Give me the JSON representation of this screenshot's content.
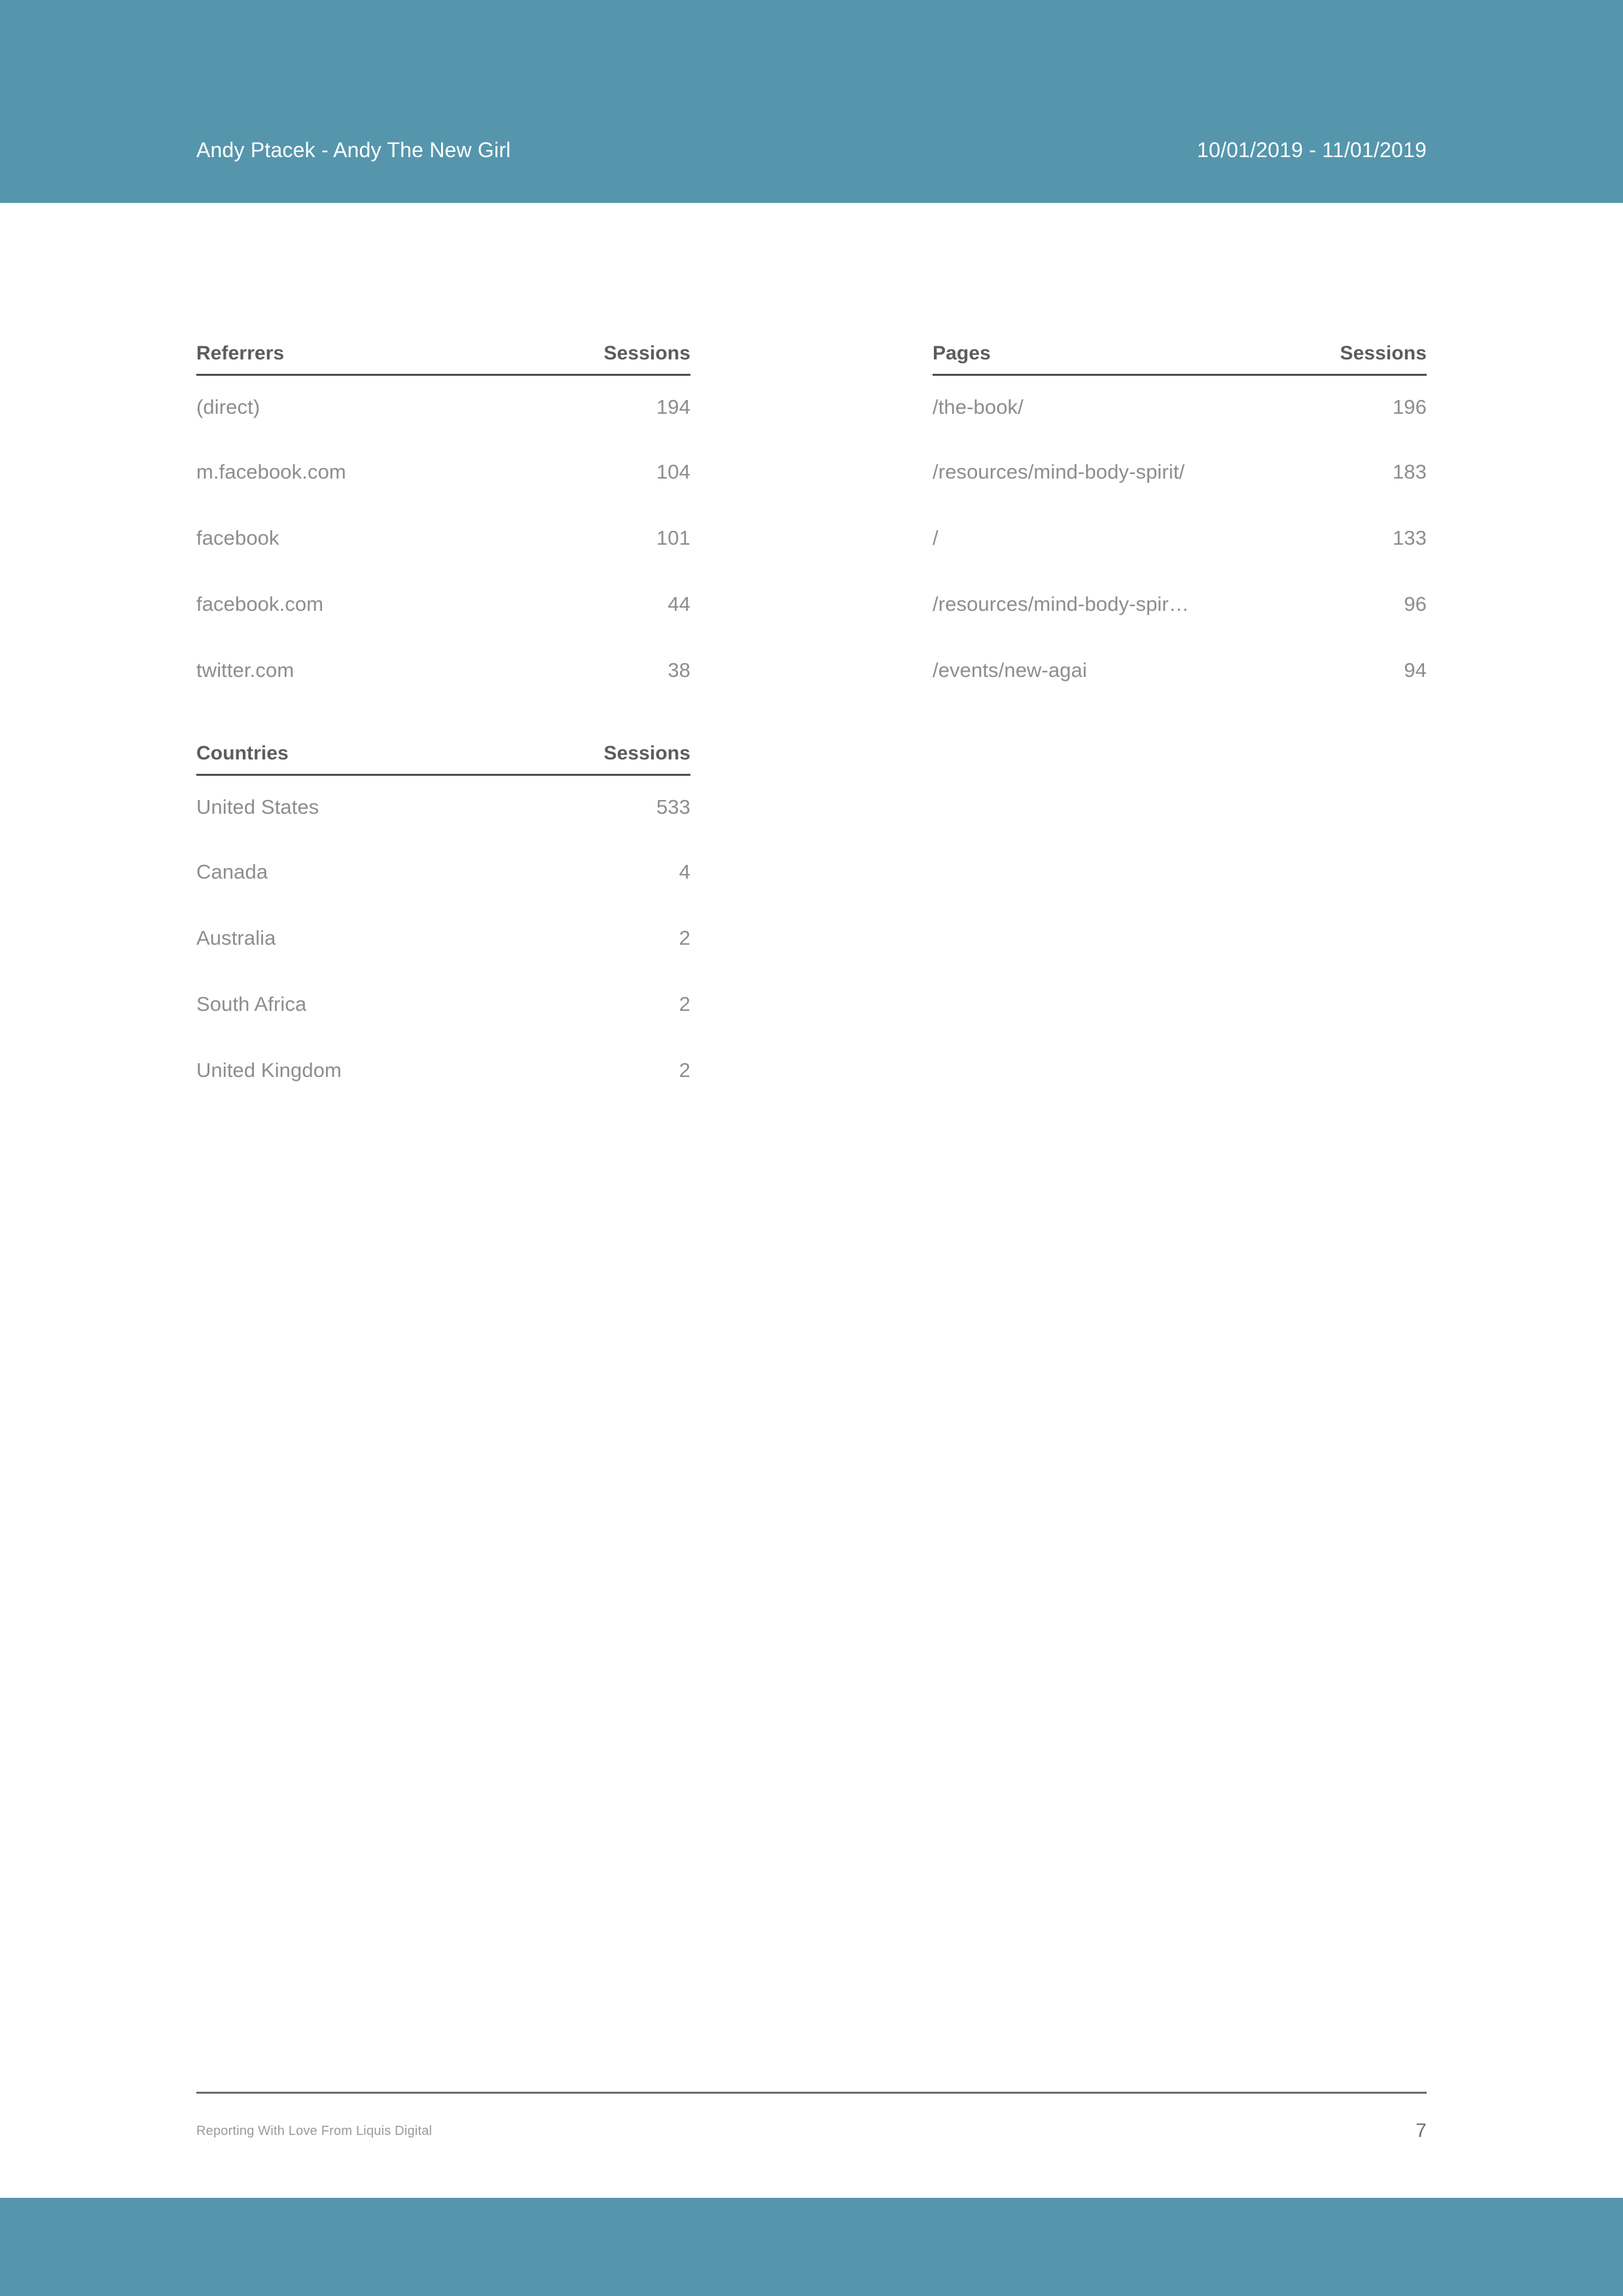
{
  "brand": {
    "band_color": "#5596ad",
    "header_text_color": "#ffffff",
    "rule_color": "#4c4c50",
    "header_label_color": "#5c5c60",
    "row_text_color": "#8d8d91"
  },
  "header": {
    "title": "Andy Ptacek - Andy The New Girl",
    "date_range": "10/01/2019 - 11/01/2019"
  },
  "tables": {
    "referrers": {
      "columns": [
        "Referrers",
        "Sessions"
      ],
      "rows": [
        {
          "label": "(direct)",
          "value": "194"
        },
        {
          "label": "m.facebook.com",
          "value": "104"
        },
        {
          "label": "facebook",
          "value": "101"
        },
        {
          "label": "facebook.com",
          "value": "44"
        },
        {
          "label": "twitter.com",
          "value": "38"
        }
      ]
    },
    "countries": {
      "columns": [
        "Countries",
        "Sessions"
      ],
      "rows": [
        {
          "label": "United States",
          "value": "533"
        },
        {
          "label": "Canada",
          "value": "4"
        },
        {
          "label": "Australia",
          "value": "2"
        },
        {
          "label": "South Africa",
          "value": "2"
        },
        {
          "label": "United Kingdom",
          "value": "2"
        }
      ]
    },
    "pages": {
      "columns": [
        "Pages",
        "Sessions"
      ],
      "rows": [
        {
          "label": "/the-book/",
          "value": "196"
        },
        {
          "label": "/resources/mind-body-spirit/",
          "value": "183"
        },
        {
          "label": "/",
          "value": "133"
        },
        {
          "label": "/resources/mind-body-spir…",
          "value": "96"
        },
        {
          "label": "/events/new-agai",
          "value": "94"
        }
      ]
    }
  },
  "footer": {
    "note": "Reporting With Love From Liquis Digital",
    "page_number": "7"
  }
}
